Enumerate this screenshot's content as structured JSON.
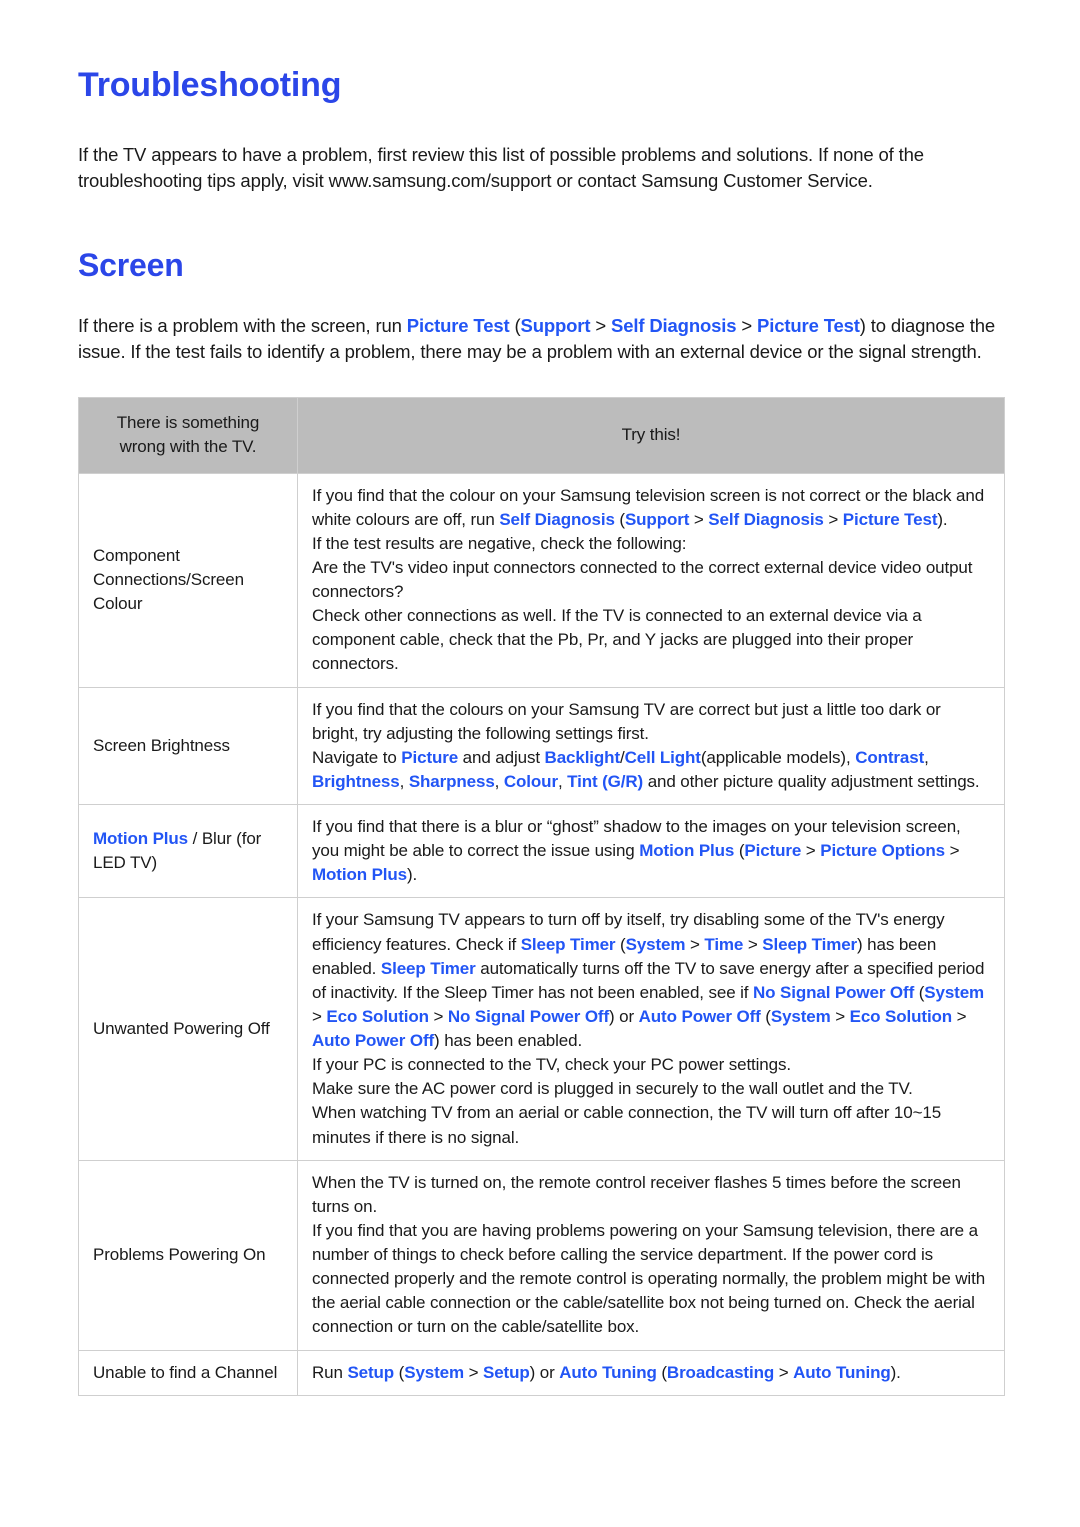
{
  "document": {
    "title": "Troubleshooting",
    "intro": "If the TV appears to have a problem, first review this list of possible problems and solutions. If none of the troubleshooting tips apply, visit www.samsung.com/support or contact Samsung Customer Service.",
    "section_title": "Screen",
    "section_intro_pre": "If there is a problem with the screen, run ",
    "section_intro_links": {
      "picture_test": "Picture Test",
      "support": "Support",
      "self_diagnosis": "Self Diagnosis",
      "picture_test_2": "Picture Test"
    },
    "section_intro_post": ") to diagnose the issue. If the test fails to identify a problem, there may be a problem with an external device or the signal strength."
  },
  "colors": {
    "heading_blue": "#2b46e8",
    "link_blue": "#2255f5",
    "table_header_bg": "#bcbcbc",
    "table_border": "#cfcfcf",
    "text": "#1a1a1a"
  },
  "table": {
    "headers": {
      "problem": "There is something wrong with the TV.",
      "solution": "Try this!"
    },
    "rows": [
      {
        "label": "Component Connections/Screen Colour",
        "label_parts": [
          "Component Connections/Screen Colour"
        ],
        "paragraphs": [
          "If you find that the colour on your Samsung television screen is not correct or the black and white colours are off, run Self Diagnosis (Support > Self Diagnosis > Picture Test).",
          "If the test results are negative, check the following:",
          "Are the TV's video input connectors connected to the correct external device video output connectors?",
          "Check other connections as well. If the TV is connected to an external device via a component cable, check that the Pb, Pr, and Y jacks are plugged into their proper connectors."
        ],
        "links": [
          "Self Diagnosis",
          "Support",
          "Self Diagnosis",
          "Picture Test"
        ]
      },
      {
        "label": "Screen Brightness",
        "paragraphs": [
          "If you find that the colours on your Samsung TV are correct but just a little too dark or bright, try adjusting the following settings first.",
          "Navigate to Picture and adjust Backlight/Cell Light(applicable models), Contrast, Brightness, Sharpness, Colour, Tint (G/R) and other picture quality adjustment settings."
        ],
        "links": [
          "Picture",
          "Backlight",
          "Cell Light",
          "Contrast",
          "Brightness",
          "Sharpness",
          "Colour",
          "Tint (G/R)"
        ]
      },
      {
        "label": "Motion Plus / Blur (for LED TV)",
        "label_link": "Motion Plus",
        "label_rest": " / Blur (for LED TV)",
        "paragraphs": [
          "If you find that there is a blur or “ghost” shadow to the images on your television screen, you might be able to correct the issue using Motion Plus (Picture > Picture Options > Motion Plus)."
        ],
        "links": [
          "Motion Plus",
          "Picture",
          "Picture Options",
          "Motion Plus"
        ]
      },
      {
        "label": "Unwanted Powering Off",
        "paragraphs": [
          "If your Samsung TV appears to turn off by itself, try disabling some of the TV's energy efficiency features. Check if Sleep Timer (System > Time > Sleep Timer) has been enabled. Sleep Timer automatically turns off the TV to save energy after a specified period of inactivity. If the Sleep Timer has not been enabled, see if No Signal Power Off (System > Eco Solution > No Signal Power Off) or Auto Power Off (System > Eco Solution > Auto Power Off) has been enabled.",
          "If your PC is connected to the TV, check your PC power settings.",
          "Make sure the AC power cord is plugged in securely to the wall outlet and the TV.",
          "When watching TV from an aerial or cable connection, the TV will turn off after 10~15 minutes if there is no signal."
        ],
        "links": [
          "Sleep Timer",
          "System",
          "Time",
          "Sleep Timer",
          "Sleep Timer",
          "No Signal Power Off",
          "System",
          "Eco Solution",
          "No Signal Power Off",
          "Auto Power Off",
          "System",
          "Eco Solution",
          "Auto Power Off"
        ]
      },
      {
        "label": "Problems Powering On",
        "paragraphs": [
          "When the TV is turned on, the remote control receiver flashes 5 times before the screen turns on.",
          "If you find that you are having problems powering on your Samsung television, there are a number of things to check before calling the service department. If the power cord is connected properly and the remote control is operating normally, the problem might be with the aerial cable connection or the cable/satellite box not being turned on. Check the aerial connection or turn on the cable/satellite box."
        ],
        "links": []
      },
      {
        "label": "Unable to find a Channel",
        "paragraphs": [
          "Run Setup (System > Setup) or Auto Tuning (Broadcasting > Auto Tuning)."
        ],
        "links": [
          "Setup",
          "System",
          "Setup",
          "Auto Tuning",
          "Broadcasting",
          "Auto Tuning"
        ]
      }
    ]
  }
}
